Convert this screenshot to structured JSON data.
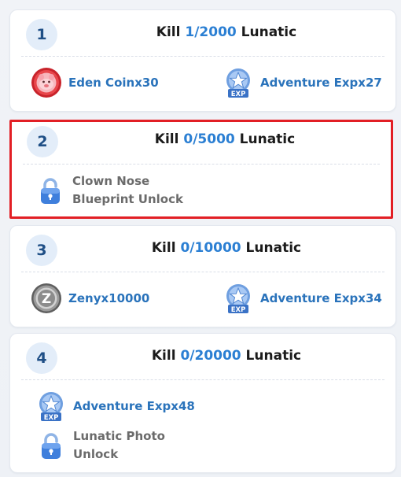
{
  "tasks": [
    {
      "number": "1",
      "title_prefix": "Kill ",
      "progress": "1/2000",
      "title_suffix": " Lunatic",
      "rewards": [
        {
          "icon": "eden-coin-icon",
          "label": "Eden Coinx30"
        },
        {
          "icon": "adventure-exp-icon",
          "label": "Adventure Expx27",
          "icon_text": "EXP"
        }
      ]
    },
    {
      "number": "2",
      "title_prefix": "Kill ",
      "progress": "0/5000",
      "title_suffix": " Lunatic",
      "rewards": [
        {
          "icon": "lock-icon",
          "line1": "Clown Nose",
          "line2": "Blueprint Unlock"
        }
      ]
    },
    {
      "number": "3",
      "title_prefix": "Kill ",
      "progress": "0/10000",
      "title_suffix": " Lunatic",
      "rewards": [
        {
          "icon": "zeny-coin-icon",
          "label": "Zenyx10000",
          "icon_text": "Z"
        },
        {
          "icon": "adventure-exp-icon",
          "label": "Adventure Expx34",
          "icon_text": "EXP"
        }
      ]
    },
    {
      "number": "4",
      "title_prefix": "Kill ",
      "progress": "0/20000",
      "title_suffix": " Lunatic",
      "rewards": [
        {
          "icon": "adventure-exp-icon",
          "label": "Adventure Expx48",
          "icon_text": "EXP"
        },
        {
          "icon": "lock-icon",
          "line1": "Lunatic Photo",
          "line2": "Unlock"
        }
      ]
    }
  ],
  "colors": {
    "progress": "#2b7fd3",
    "reward_text": "#2a73bb",
    "highlight_border": "#e21f25",
    "badge_bg": "#e3edf9"
  }
}
